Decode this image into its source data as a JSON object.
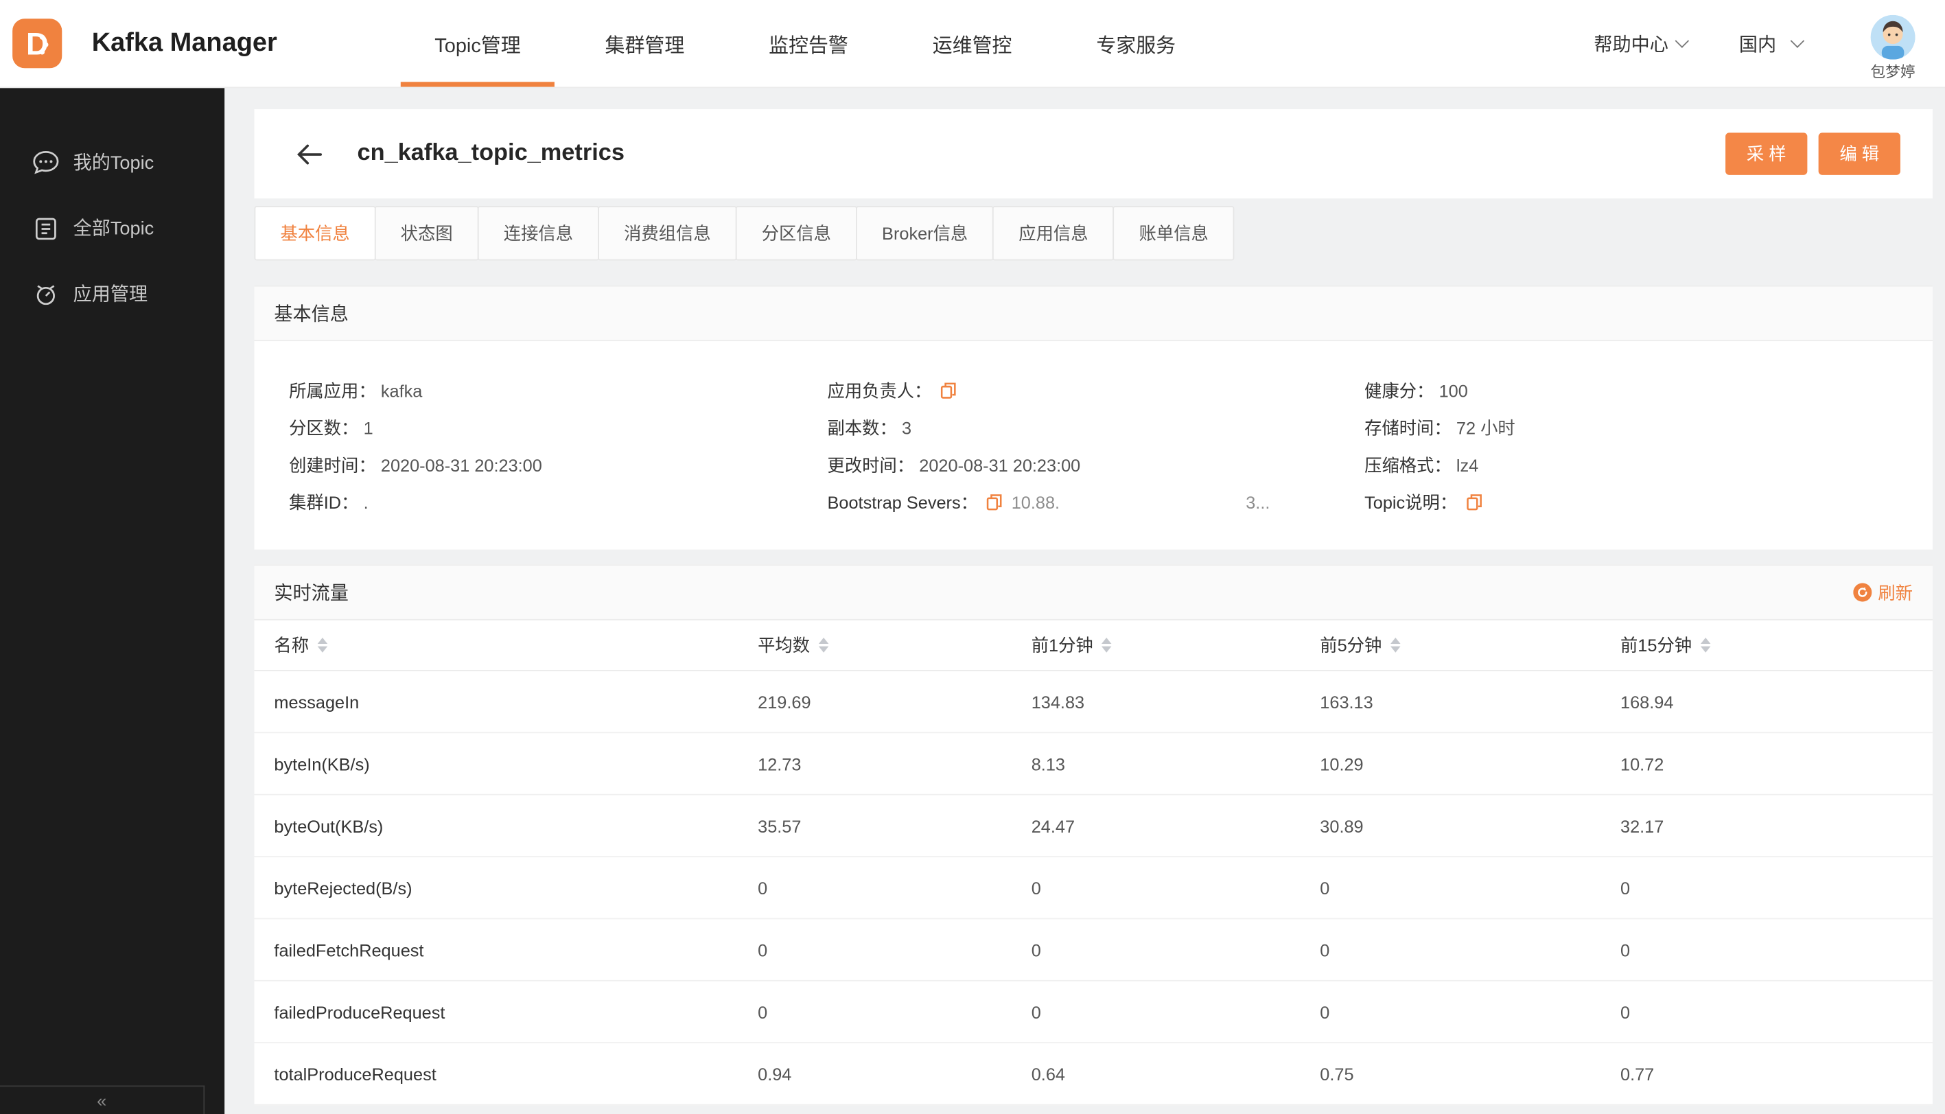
{
  "accent": "#f0823f",
  "header": {
    "title": "Kafka Manager",
    "nav": [
      {
        "label": "Topic管理"
      },
      {
        "label": "集群管理"
      },
      {
        "label": "监控告警"
      },
      {
        "label": "运维管控"
      },
      {
        "label": "专家服务"
      }
    ],
    "help_label": "帮助中心",
    "region_label": "国内",
    "user_name": "包梦婷"
  },
  "sidebar": {
    "items": [
      {
        "label": "我的Topic",
        "icon": "chat-icon"
      },
      {
        "label": "全部Topic",
        "icon": "clipboard-icon"
      },
      {
        "label": "应用管理",
        "icon": "app-management-icon"
      }
    ],
    "collapse_glyph": "«"
  },
  "page": {
    "back_glyph": "←",
    "title": "cn_kafka_topic_metrics",
    "sample_button": "采 样",
    "edit_button": "编 辑",
    "tabs": [
      "基本信息",
      "状态图",
      "连接信息",
      "消费组信息",
      "分区信息",
      "Broker信息",
      "应用信息",
      "账单信息"
    ]
  },
  "basic_info": {
    "section_title": "基本信息",
    "fields": [
      {
        "label": "所属应用：",
        "value": "kafka"
      },
      {
        "label": "应用负责人：",
        "value": "",
        "copy": true
      },
      {
        "label": "健康分：",
        "value": "100"
      },
      {
        "label": "分区数：",
        "value": "1"
      },
      {
        "label": "副本数：",
        "value": "3"
      },
      {
        "label": "存储时间：",
        "value": "72 小时"
      },
      {
        "label": "创建时间：",
        "value": "2020-08-31 20:23:00"
      },
      {
        "label": "更改时间：",
        "value": "2020-08-31 20:23:00"
      },
      {
        "label": "压缩格式：",
        "value": "lz4"
      },
      {
        "label": "集群ID：",
        "value": "."
      },
      {
        "label": "Bootstrap Severs：",
        "value": "10.88.",
        "value_extra": "3...",
        "copy": true
      },
      {
        "label": "Topic说明：",
        "value": "",
        "copy": true
      }
    ]
  },
  "realtime": {
    "section_title": "实时流量",
    "refresh_label": "刷新",
    "table": {
      "columns": [
        "名称",
        "平均数",
        "前1分钟",
        "前5分钟",
        "前15分钟"
      ],
      "rows": [
        {
          "name": "messageIn",
          "avg": "219.69",
          "min1": "134.83",
          "min5": "163.13",
          "min15": "168.94"
        },
        {
          "name": "byteIn(KB/s)",
          "avg": "12.73",
          "min1": "8.13",
          "min5": "10.29",
          "min15": "10.72"
        },
        {
          "name": "byteOut(KB/s)",
          "avg": "35.57",
          "min1": "24.47",
          "min5": "30.89",
          "min15": "32.17"
        },
        {
          "name": "byteRejected(B/s)",
          "avg": "0",
          "min1": "0",
          "min5": "0",
          "min15": "0"
        },
        {
          "name": "failedFetchRequest",
          "avg": "0",
          "min1": "0",
          "min5": "0",
          "min15": "0"
        },
        {
          "name": "failedProduceRequest",
          "avg": "0",
          "min1": "0",
          "min5": "0",
          "min15": "0"
        },
        {
          "name": "totalProduceRequest",
          "avg": "0.94",
          "min1": "0.64",
          "min5": "0.75",
          "min15": "0.77"
        }
      ]
    }
  }
}
